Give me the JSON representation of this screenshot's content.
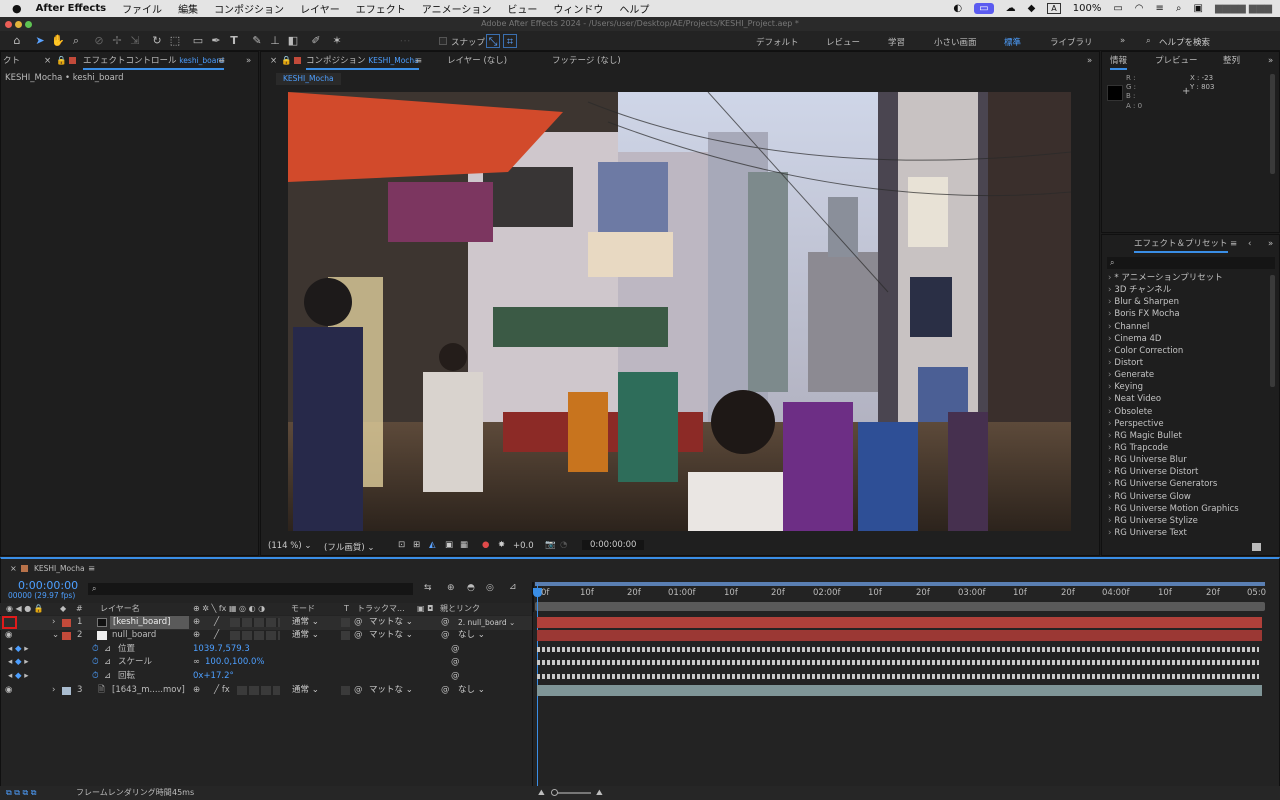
{
  "menubar": {
    "app": "After Effects",
    "items": [
      "ファイル",
      "編集",
      "コンポジション",
      "レイヤー",
      "エフェクト",
      "アニメーション",
      "ビュー",
      "ウィンドウ",
      "ヘルプ"
    ],
    "battery": "100%",
    "a_label": "A"
  },
  "titlebar": {
    "title": "Adobe After Effects 2024 - /Users/user/Desktop/AE/Projects/KESHI_Project.aep *"
  },
  "toolbar": {
    "snap_label": "スナップ",
    "workspaces": [
      "デフォルト",
      "レビュー",
      "学習",
      "小さい画面",
      "標準",
      "ライブラリ"
    ],
    "search_placeholder": "ヘルプを検索"
  },
  "effect_controls": {
    "tab_left": "クト",
    "tab_label": "エフェクトコントロール",
    "tab_target": "keshi_board",
    "path": "KESHI_Mocha • keshi_board"
  },
  "viewer": {
    "tab_label": "コンポジション",
    "tab_target": "KESHI_Mocha",
    "tab_layer": "レイヤー (なし)",
    "tab_footage": "フッテージ (なし)",
    "sub_tab": "KESHI_Mocha",
    "zoom": "(114 %)",
    "resolution": "(フル画質)",
    "exposure": "+0.0",
    "timecode": "0:00:00:00"
  },
  "info_panel": {
    "tabs": [
      "情報",
      "プレビュー",
      "整列"
    ],
    "r": "R :",
    "g": "G :",
    "b": "B :",
    "a": "A : 0",
    "x": "X : -23",
    "y": "Y : 803"
  },
  "effects_presets": {
    "title": "エフェクト＆プリセット",
    "items": [
      "* アニメーションプリセット",
      "3D チャンネル",
      "Blur & Sharpen",
      "Boris FX Mocha",
      "Channel",
      "Cinema 4D",
      "Color Correction",
      "Distort",
      "Generate",
      "Keying",
      "Neat Video",
      "Obsolete",
      "Perspective",
      "RG Magic Bullet",
      "RG Trapcode",
      "RG Universe Blur",
      "RG Universe Distort",
      "RG Universe Generators",
      "RG Universe Glow",
      "RG Universe Motion Graphics",
      "RG Universe Stylize",
      "RG Universe Text"
    ]
  },
  "timeline": {
    "comp_tab": "KESHI_Mocha",
    "timecode": "0:00:00:00",
    "frame_info": "00000 (29.97 fps)",
    "headers": {
      "num": "#",
      "layer_name": "レイヤー名",
      "mode": "モード",
      "t": "T",
      "track_matte": "トラックマ...",
      "parent": "親とリンク"
    },
    "ruler": [
      "0f",
      "10f",
      "20f",
      "01:00f",
      "10f",
      "20f",
      "02:00f",
      "10f",
      "20f",
      "03:00f",
      "10f",
      "20f",
      "04:00f",
      "10f",
      "20f",
      "05:0"
    ],
    "layers": [
      {
        "num": "1",
        "name": "[keshi_board]",
        "mode": "通常",
        "matte": "マットな",
        "parent": "2. null_board"
      },
      {
        "num": "2",
        "name": "null_board",
        "mode": "通常",
        "matte": "マットな",
        "parent": "なし"
      },
      {
        "num": "3",
        "name": "[1643_m.....mov]",
        "mode": "通常",
        "matte": "マットな",
        "parent": "なし"
      }
    ],
    "props": [
      {
        "name": "位置",
        "value": "1039.7,579.3"
      },
      {
        "name": "スケール",
        "value": "100.0,100.0%"
      },
      {
        "name": "回転",
        "value": "0x+17.2°"
      }
    ],
    "status": "フレームレンダリング時間",
    "render_time": "45ms"
  }
}
